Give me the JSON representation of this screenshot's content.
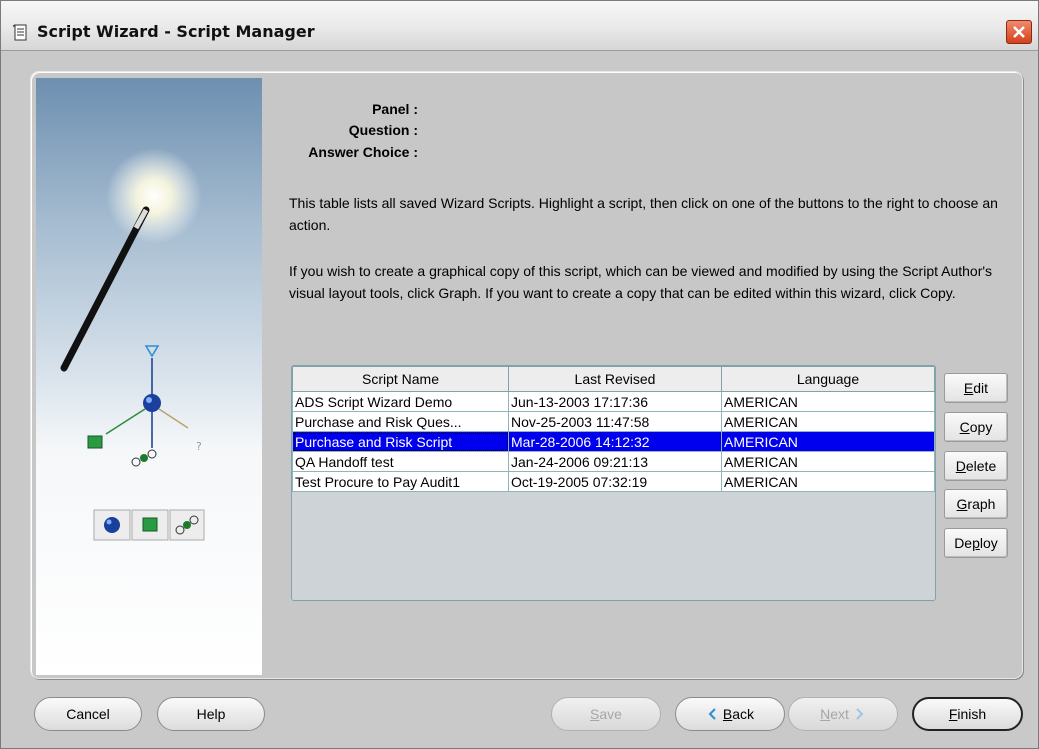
{
  "window": {
    "title": "Script Wizard - Script Manager",
    "close_icon": "close-icon"
  },
  "header": {
    "panel_label": "Panel :",
    "question_label": "Question :",
    "answer_label": "Answer Choice :"
  },
  "instructions": {
    "p1": "This table lists all saved Wizard Scripts. Highlight a script, then click on one of the buttons to the right to choose an action.",
    "p2": "If you wish to create a graphical copy of this script, which can be viewed and modified by using the Script Author's visual layout tools, click Graph.  If you want to create a copy that can be edited within this wizard, click Copy."
  },
  "table": {
    "columns": [
      "Script Name",
      "Last Revised",
      "Language"
    ],
    "rows": [
      [
        "ADS Script Wizard Demo",
        "Jun-13-2003 17:17:36",
        "AMERICAN"
      ],
      [
        "Purchase and Risk Ques...",
        "Nov-25-2003 11:47:58",
        "AMERICAN"
      ],
      [
        "Purchase and Risk Script",
        "Mar-28-2006 14:12:32",
        "AMERICAN"
      ],
      [
        "QA Handoff test",
        "Jan-24-2006 09:21:13",
        "AMERICAN"
      ],
      [
        "Test Procure to Pay Audit1",
        "Oct-19-2005 07:32:19",
        "AMERICAN"
      ]
    ],
    "selected_row": 2,
    "selection_color": "#0000ee"
  },
  "actions": {
    "edit": {
      "mnemonic": "E",
      "rest": "dit"
    },
    "copy": {
      "mnemonic": "C",
      "rest": "opy"
    },
    "delete": {
      "mnemonic": "D",
      "rest": "elete"
    },
    "graph": {
      "mnemonic": "G",
      "rest": "raph"
    },
    "deploy": {
      "pre": "De",
      "mnemonic": "p",
      "rest": "loy"
    }
  },
  "footer": {
    "cancel": "Cancel",
    "help": "Help",
    "save": {
      "mnemonic": "S",
      "rest": "ave"
    },
    "back": {
      "mnemonic": "B",
      "rest": "ack"
    },
    "next": {
      "mnemonic": "N",
      "rest": "ext"
    },
    "finish": {
      "mnemonic": "F",
      "rest": "inish"
    }
  }
}
